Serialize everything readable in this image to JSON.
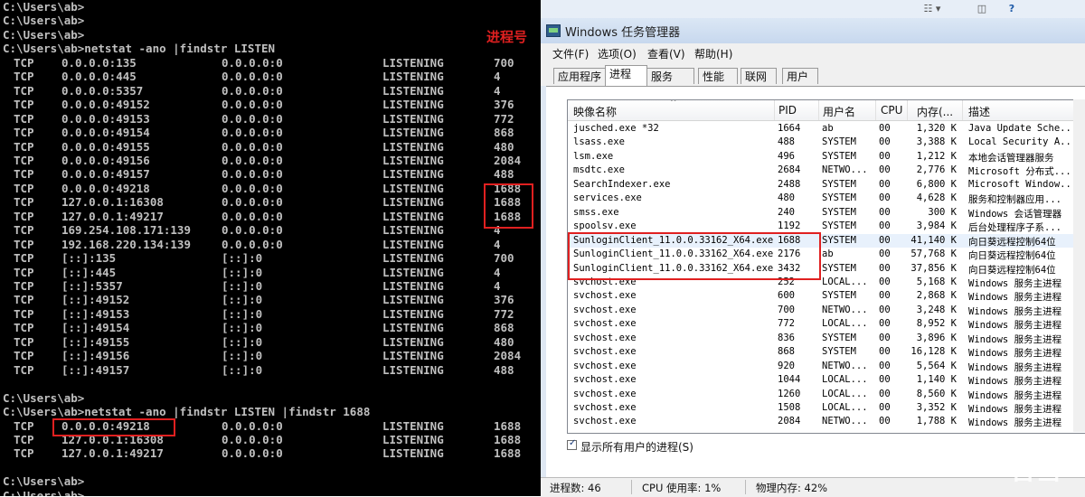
{
  "cmd": {
    "line1": "C:\\Users\\ab>",
    "line2": "C:\\Users\\ab>",
    "line3": "C:\\Users\\ab>",
    "command1": "C:\\Users\\ab>netstat -ano |findstr LISTEN",
    "annotation": "进程号",
    "rows": [
      {
        "proto": "TCP",
        "local": "0.0.0.0:135",
        "foreign": "0.0.0.0:0",
        "state": "LISTENING",
        "pid": "700"
      },
      {
        "proto": "TCP",
        "local": "0.0.0.0:445",
        "foreign": "0.0.0.0:0",
        "state": "LISTENING",
        "pid": "4"
      },
      {
        "proto": "TCP",
        "local": "0.0.0.0:5357",
        "foreign": "0.0.0.0:0",
        "state": "LISTENING",
        "pid": "4"
      },
      {
        "proto": "TCP",
        "local": "0.0.0.0:49152",
        "foreign": "0.0.0.0:0",
        "state": "LISTENING",
        "pid": "376"
      },
      {
        "proto": "TCP",
        "local": "0.0.0.0:49153",
        "foreign": "0.0.0.0:0",
        "state": "LISTENING",
        "pid": "772"
      },
      {
        "proto": "TCP",
        "local": "0.0.0.0:49154",
        "foreign": "0.0.0.0:0",
        "state": "LISTENING",
        "pid": "868"
      },
      {
        "proto": "TCP",
        "local": "0.0.0.0:49155",
        "foreign": "0.0.0.0:0",
        "state": "LISTENING",
        "pid": "480"
      },
      {
        "proto": "TCP",
        "local": "0.0.0.0:49156",
        "foreign": "0.0.0.0:0",
        "state": "LISTENING",
        "pid": "2084"
      },
      {
        "proto": "TCP",
        "local": "0.0.0.0:49157",
        "foreign": "0.0.0.0:0",
        "state": "LISTENING",
        "pid": "488"
      },
      {
        "proto": "TCP",
        "local": "0.0.0.0:49218",
        "foreign": "0.0.0.0:0",
        "state": "LISTENING",
        "pid": "1688"
      },
      {
        "proto": "TCP",
        "local": "127.0.0.1:16308",
        "foreign": "0.0.0.0:0",
        "state": "LISTENING",
        "pid": "1688"
      },
      {
        "proto": "TCP",
        "local": "127.0.0.1:49217",
        "foreign": "0.0.0.0:0",
        "state": "LISTENING",
        "pid": "1688"
      },
      {
        "proto": "TCP",
        "local": "169.254.108.171:139",
        "foreign": "0.0.0.0:0",
        "state": "LISTENING",
        "pid": "4"
      },
      {
        "proto": "TCP",
        "local": "192.168.220.134:139",
        "foreign": "0.0.0.0:0",
        "state": "LISTENING",
        "pid": "4"
      },
      {
        "proto": "TCP",
        "local": "[::]:135",
        "foreign": "[::]:0",
        "state": "LISTENING",
        "pid": "700"
      },
      {
        "proto": "TCP",
        "local": "[::]:445",
        "foreign": "[::]:0",
        "state": "LISTENING",
        "pid": "4"
      },
      {
        "proto": "TCP",
        "local": "[::]:5357",
        "foreign": "[::]:0",
        "state": "LISTENING",
        "pid": "4"
      },
      {
        "proto": "TCP",
        "local": "[::]:49152",
        "foreign": "[::]:0",
        "state": "LISTENING",
        "pid": "376"
      },
      {
        "proto": "TCP",
        "local": "[::]:49153",
        "foreign": "[::]:0",
        "state": "LISTENING",
        "pid": "772"
      },
      {
        "proto": "TCP",
        "local": "[::]:49154",
        "foreign": "[::]:0",
        "state": "LISTENING",
        "pid": "868"
      },
      {
        "proto": "TCP",
        "local": "[::]:49155",
        "foreign": "[::]:0",
        "state": "LISTENING",
        "pid": "480"
      },
      {
        "proto": "TCP",
        "local": "[::]:49156",
        "foreign": "[::]:0",
        "state": "LISTENING",
        "pid": "2084"
      },
      {
        "proto": "TCP",
        "local": "[::]:49157",
        "foreign": "[::]:0",
        "state": "LISTENING",
        "pid": "488"
      }
    ],
    "prompt_after": "C:\\Users\\ab>",
    "command2": "C:\\Users\\ab>netstat -ano |findstr LISTEN |findstr 1688",
    "rows2": [
      {
        "proto": "TCP",
        "local": "0.0.0.0:49218",
        "foreign": "0.0.0.0:0",
        "state": "LISTENING",
        "pid": "1688"
      },
      {
        "proto": "TCP",
        "local": "127.0.0.1:16308",
        "foreign": "0.0.0.0:0",
        "state": "LISTENING",
        "pid": "1688"
      },
      {
        "proto": "TCP",
        "local": "127.0.0.1:49217",
        "foreign": "0.0.0.0:0",
        "state": "LISTENING",
        "pid": "1688"
      }
    ],
    "prompt_end": "C:\\Users\\ab>",
    "prompt_last": "C:\\Users\\ab>"
  },
  "taskmgr": {
    "title": "Windows 任务管理器",
    "menu": [
      "文件(F)",
      "选项(O)",
      "查看(V)",
      "帮助(H)"
    ],
    "tabs": [
      "应用程序",
      "进程",
      "服务",
      "性能",
      "联网",
      "用户"
    ],
    "active_tab": "进程",
    "columns": [
      "映像名称",
      "PID",
      "用户名",
      "CPU",
      "内存(...",
      "描述"
    ],
    "processes": [
      {
        "name": "jusched.exe *32",
        "pid": "1664",
        "user": "ab",
        "cpu": "00",
        "mem": "1,320 K",
        "desc": "Java Update Sche..."
      },
      {
        "name": "lsass.exe",
        "pid": "488",
        "user": "SYSTEM",
        "cpu": "00",
        "mem": "3,388 K",
        "desc": "Local Security A..."
      },
      {
        "name": "lsm.exe",
        "pid": "496",
        "user": "SYSTEM",
        "cpu": "00",
        "mem": "1,212 K",
        "desc": "本地会话管理器服务"
      },
      {
        "name": "msdtc.exe",
        "pid": "2684",
        "user": "NETWO...",
        "cpu": "00",
        "mem": "2,776 K",
        "desc": "Microsoft 分布式..."
      },
      {
        "name": "SearchIndexer.exe",
        "pid": "2488",
        "user": "SYSTEM",
        "cpu": "00",
        "mem": "6,800 K",
        "desc": "Microsoft Window..."
      },
      {
        "name": "services.exe",
        "pid": "480",
        "user": "SYSTEM",
        "cpu": "00",
        "mem": "4,628 K",
        "desc": "服务和控制器应用..."
      },
      {
        "name": "smss.exe",
        "pid": "240",
        "user": "SYSTEM",
        "cpu": "00",
        "mem": "300 K",
        "desc": "Windows 会话管理器"
      },
      {
        "name": "spoolsv.exe",
        "pid": "1192",
        "user": "SYSTEM",
        "cpu": "00",
        "mem": "3,984 K",
        "desc": "后台处理程序子系..."
      },
      {
        "name": "SunloginClient_11.0.0.33162_X64.exe",
        "pid": "1688",
        "user": "SYSTEM",
        "cpu": "00",
        "mem": "41,140 K",
        "desc": "向日葵远程控制64位"
      },
      {
        "name": "SunloginClient_11.0.0.33162_X64.exe",
        "pid": "2176",
        "user": "ab",
        "cpu": "00",
        "mem": "57,768 K",
        "desc": "向日葵远程控制64位"
      },
      {
        "name": "SunloginClient_11.0.0.33162_X64.exe",
        "pid": "3432",
        "user": "SYSTEM",
        "cpu": "00",
        "mem": "37,856 K",
        "desc": "向日葵远程控制64位"
      },
      {
        "name": "svchost.exe",
        "pid": "252",
        "user": "LOCAL...",
        "cpu": "00",
        "mem": "5,168 K",
        "desc": "Windows 服务主进程"
      },
      {
        "name": "svchost.exe",
        "pid": "600",
        "user": "SYSTEM",
        "cpu": "00",
        "mem": "2,868 K",
        "desc": "Windows 服务主进程"
      },
      {
        "name": "svchost.exe",
        "pid": "700",
        "user": "NETWO...",
        "cpu": "00",
        "mem": "3,248 K",
        "desc": "Windows 服务主进程"
      },
      {
        "name": "svchost.exe",
        "pid": "772",
        "user": "LOCAL...",
        "cpu": "00",
        "mem": "8,952 K",
        "desc": "Windows 服务主进程"
      },
      {
        "name": "svchost.exe",
        "pid": "836",
        "user": "SYSTEM",
        "cpu": "00",
        "mem": "3,896 K",
        "desc": "Windows 服务主进程"
      },
      {
        "name": "svchost.exe",
        "pid": "868",
        "user": "SYSTEM",
        "cpu": "00",
        "mem": "16,128 K",
        "desc": "Windows 服务主进程"
      },
      {
        "name": "svchost.exe",
        "pid": "920",
        "user": "NETWO...",
        "cpu": "00",
        "mem": "5,564 K",
        "desc": "Windows 服务主进程"
      },
      {
        "name": "svchost.exe",
        "pid": "1044",
        "user": "LOCAL...",
        "cpu": "00",
        "mem": "1,140 K",
        "desc": "Windows 服务主进程"
      },
      {
        "name": "svchost.exe",
        "pid": "1260",
        "user": "LOCAL...",
        "cpu": "00",
        "mem": "8,560 K",
        "desc": "Windows 服务主进程"
      },
      {
        "name": "svchost.exe",
        "pid": "1508",
        "user": "LOCAL...",
        "cpu": "00",
        "mem": "3,352 K",
        "desc": "Windows 服务主进程"
      },
      {
        "name": "svchost.exe",
        "pid": "2084",
        "user": "NETWO...",
        "cpu": "00",
        "mem": "1,788 K",
        "desc": "Windows 服务主进程"
      }
    ],
    "show_all_label": "显示所有用户的进程(S)",
    "status": {
      "processes": "进程数: 46",
      "cpu": "CPU 使用率: 1%",
      "memory": "物理内存: 42%"
    },
    "watermark": "看雪"
  },
  "colors": {
    "annotation": "#e02020",
    "console_bg": "#000000",
    "console_fg": "#c0c0c0"
  }
}
